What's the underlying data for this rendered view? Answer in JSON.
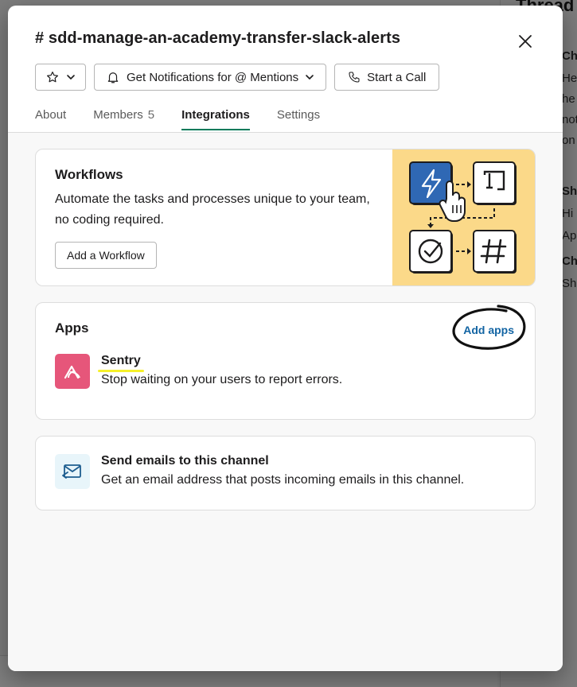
{
  "background": {
    "thread_title": "Thread",
    "snippets": [
      "Chr",
      "Hel",
      "he",
      "not",
      "on",
      "Sha",
      "Hi",
      "App",
      "Chr",
      "Sha"
    ]
  },
  "modal": {
    "channel_title": "# sdd-manage-an-academy-transfer-slack-alerts",
    "actions": {
      "star_icon": "star-icon",
      "notifications_label": "Get Notifications for @ Mentions",
      "call_label": "Start a Call"
    },
    "tabs": [
      {
        "label": "About",
        "count": ""
      },
      {
        "label": "Members",
        "count": "5"
      },
      {
        "label": "Integrations",
        "count": ""
      },
      {
        "label": "Settings",
        "count": ""
      }
    ],
    "active_tab": "Integrations"
  },
  "workflows": {
    "title": "Workflows",
    "description": "Automate the tasks and processes unique to your team, no coding required.",
    "button_label": "Add a Workflow"
  },
  "apps": {
    "title": "Apps",
    "add_label": "Add apps",
    "items": [
      {
        "name": "Sentry",
        "description": "Stop waiting on your users to report errors.",
        "icon_color": "#e6567a"
      }
    ]
  },
  "email": {
    "title": "Send emails to this channel",
    "description": "Get an email address that posts incoming emails in this channel."
  },
  "colors": {
    "accent_tab": "#007a5a",
    "link": "#1264a3",
    "illustration_bg": "#fbd989",
    "highlight": "#f5f02a"
  }
}
